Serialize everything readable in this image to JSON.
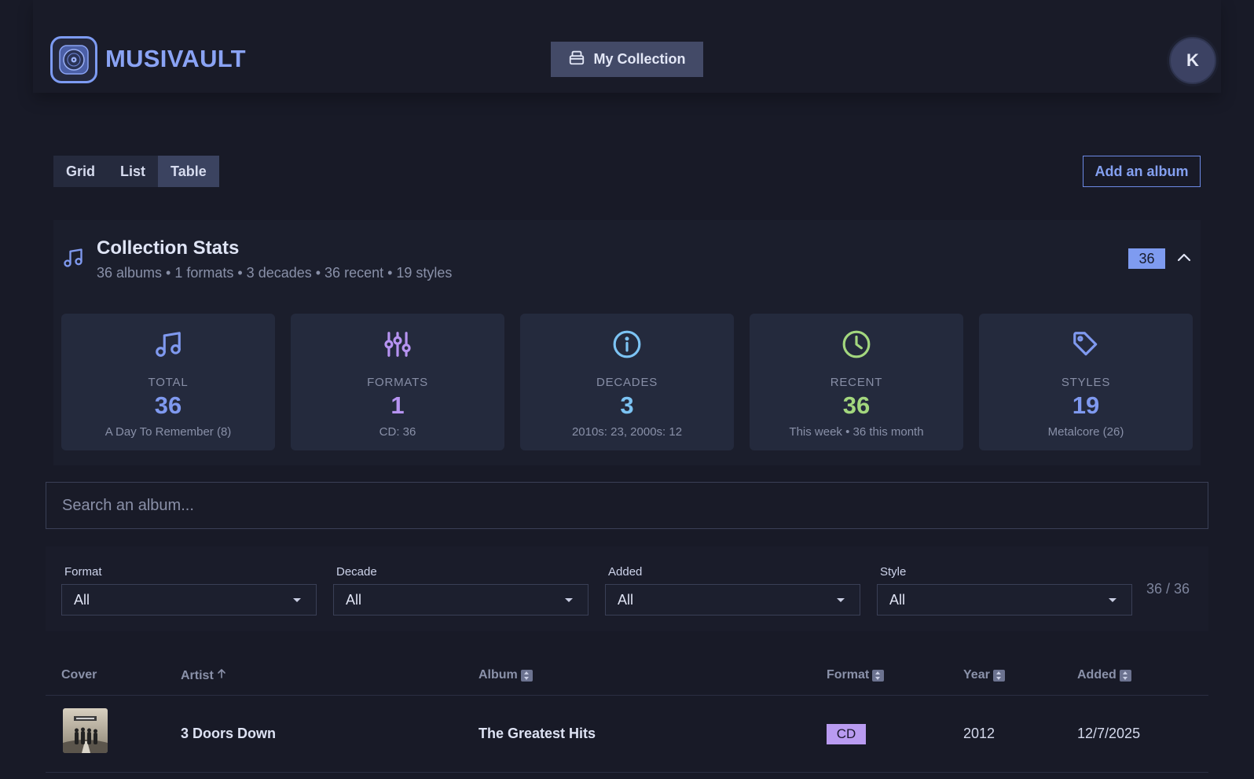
{
  "header": {
    "logo_text": "MUSIVAULT",
    "nav_label": "My Collection",
    "avatar_initial": "K"
  },
  "view_toggle": {
    "options": [
      "Grid",
      "List",
      "Table"
    ],
    "active": "Table"
  },
  "add_button_label": "Add an album",
  "stats": {
    "title": "Collection Stats",
    "subtitle": "36 albums • 1 formats • 3 decades • 36 recent • 19 styles",
    "badge_count": "36",
    "cards": [
      {
        "label": "TOTAL",
        "value": "36",
        "sub": "A Day To Remember (8)",
        "icon": "music-note-icon",
        "color": "#7f99ef"
      },
      {
        "label": "FORMATS",
        "value": "1",
        "sub": "CD: 36",
        "icon": "sliders-icon",
        "color": "#b693f1"
      },
      {
        "label": "DECADES",
        "value": "3",
        "sub": "2010s: 23, 2000s: 12",
        "icon": "info-icon",
        "color": "#7cc3f3"
      },
      {
        "label": "RECENT",
        "value": "36",
        "sub": "This week • 36 this month",
        "icon": "clock-icon",
        "color": "#a3d77e"
      },
      {
        "label": "STYLES",
        "value": "19",
        "sub": "Metalcore (26)",
        "icon": "tag-icon",
        "color": "#7f99ef"
      }
    ]
  },
  "search": {
    "placeholder": "Search an album..."
  },
  "filters": [
    {
      "label": "Format",
      "value": "All"
    },
    {
      "label": "Decade",
      "value": "All"
    },
    {
      "label": "Added",
      "value": "All"
    },
    {
      "label": "Style",
      "value": "All"
    }
  ],
  "result_count": "36 / 36",
  "table": {
    "headers": {
      "cover": "Cover",
      "artist": "Artist",
      "album": "Album",
      "format": "Format",
      "year": "Year",
      "added": "Added"
    },
    "rows": [
      {
        "artist": "3 Doors Down",
        "album": "The Greatest Hits",
        "format": "CD",
        "year": "2012",
        "added": "12/7/2025"
      }
    ]
  },
  "colors": {
    "accent": "#7f99ef",
    "background": "#181a27",
    "format_badge": "#b99bf1"
  }
}
